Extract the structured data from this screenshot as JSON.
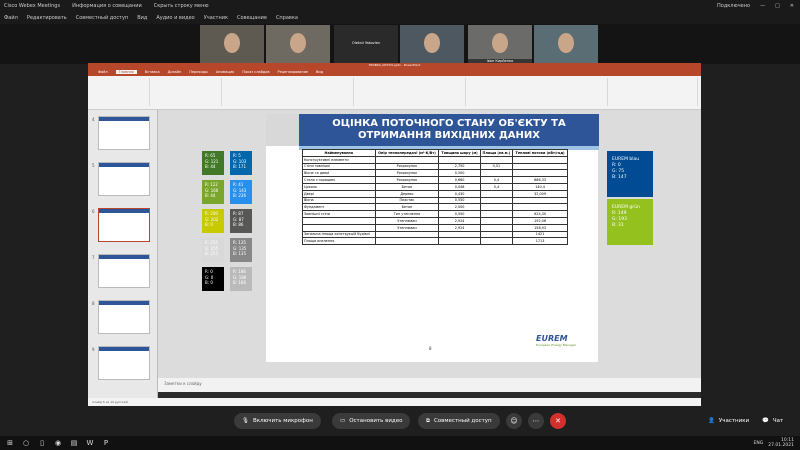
{
  "window": {
    "app_title": "Cisco Webex Meetings",
    "meeting_title": "Информация о совещании",
    "stop_title": "Скрыть строку меню",
    "status": "Подключено"
  },
  "menu": [
    "Файл",
    "Редактировать",
    "Совместный доступ",
    "Вид",
    "Аудио и видео",
    "Участник",
    "Совещание",
    "Справка"
  ],
  "participants": [
    {
      "name": ""
    },
    {
      "name": ""
    },
    {
      "name": "Oleksii Yakovlev"
    },
    {
      "name": ""
    },
    {
      "name": "Іван Кирйенко"
    },
    {
      "name": ""
    }
  ],
  "ppt": {
    "title_bar": "ПРАВКА_ИСТОЧ.pptx - PowerPoint",
    "tabs": [
      "Файл",
      "Главная",
      "Вставка",
      "Дизайн",
      "Переходы",
      "Анимация",
      "Показ слайдов",
      "Рецензирование",
      "Вид"
    ],
    "notes_placeholder": "Заметки к слайду",
    "status": "Слайд 5 из 12   русский"
  },
  "thumbnails": [
    "4",
    "5",
    "6",
    "7",
    "8",
    "9"
  ],
  "slide": {
    "title": "ОЦІНКА ПОТОЧНОГО СТАНУ ОБ'ЄКТУ ТА ОТРИМАННЯ ВИХІДНИХ ДАНИХ",
    "page_number": "8",
    "logo": "EUREM",
    "logo_sub": "European Energy Manager",
    "table_header": [
      "Найменування",
      "Опір теплопередачі (м²·К/Вт)",
      "Товщина шару (м)",
      "Площа (кв.м.)",
      "Теплові потоки (кВт/год)"
    ],
    "rows": [
      [
        "Конструктивні елементи",
        "",
        "",
        "",
        ""
      ],
      [
        "Стіни зовнішні",
        "Розрахунок",
        "2,750",
        "0,51",
        ""
      ],
      [
        "Вікна та двері",
        "Розрахунок",
        "0,500",
        "",
        ""
      ],
      [
        "Стеля з горищем",
        "Розрахунок",
        "0,660",
        "0,4",
        "686,33"
      ],
      [
        "Цоколь",
        "Бетон",
        "0,048",
        "0,4",
        "140,4"
      ],
      [
        "Двері",
        "Дерево",
        "0,430",
        "",
        "32,009"
      ],
      [
        "Вікна",
        "Пластик",
        "0,550",
        "",
        ""
      ],
      [
        "Фундамент",
        "Бетон",
        "2,000",
        "",
        ""
      ],
      [
        "Зовнішні стіни",
        "Тип утеплення",
        "0,550",
        "",
        "624,30"
      ],
      [
        "",
        "Утеплювач",
        "2,924",
        "",
        "192,06"
      ],
      [
        "",
        "Утеплювач",
        "2,924",
        "",
        "158,93"
      ],
      [
        "Загальна площа конструкцій будівлі",
        "",
        "",
        "",
        "1421"
      ],
      [
        "Площа опалення",
        "",
        "",
        "",
        "1713"
      ]
    ]
  },
  "swatches": [
    {
      "r": "R: 65",
      "g": "G: 121",
      "b": "B: 44",
      "bg": "#417928"
    },
    {
      "r": "R: 5",
      "g": "G: 103",
      "b": "B: 171",
      "bg": "#0567ab"
    },
    {
      "r": "R: 122",
      "g": "G: 166",
      "b": "B: 44",
      "bg": "#7aa62c"
    },
    {
      "r": "R: 41",
      "g": "G: 143",
      "b": "B: 236",
      "bg": "#298fec"
    },
    {
      "r": "R: 200",
      "g": "G: 202",
      "b": "B: 0",
      "bg": "#c8ca00"
    },
    {
      "r": "R: 87",
      "g": "G: 87",
      "b": "B: 86",
      "bg": "#575756"
    },
    {
      "r": "R: 255",
      "g": "G: 255",
      "b": "B: 255",
      "bg": "#d9d9d9"
    },
    {
      "r": "R: 135",
      "g": "G: 135",
      "b": "B: 135",
      "bg": "#878787"
    },
    {
      "r": "R: 0",
      "g": "G: 0",
      "b": "B: 0",
      "bg": "#000000"
    },
    {
      "r": "R: 186",
      "g": "G: 186",
      "b": "B: 186",
      "bg": "#bababa"
    }
  ],
  "big_swatches": [
    {
      "title": "EUREM blau",
      "r": "R: 0",
      "g": "G: 75",
      "b": "B: 147",
      "bg": "#004b93"
    },
    {
      "title": "EUREM grün",
      "r": "R: 149",
      "g": "G: 193",
      "b": "B: 31",
      "bg": "#95c11f"
    }
  ],
  "controls": {
    "mic": "Включить микрофон",
    "video": "Остановить видео",
    "share": "Совместный доступ",
    "participants": "Участники",
    "chat": "Чат"
  },
  "tray": {
    "lang": "ENG",
    "time": "10:11",
    "date": "27.01.2021"
  }
}
